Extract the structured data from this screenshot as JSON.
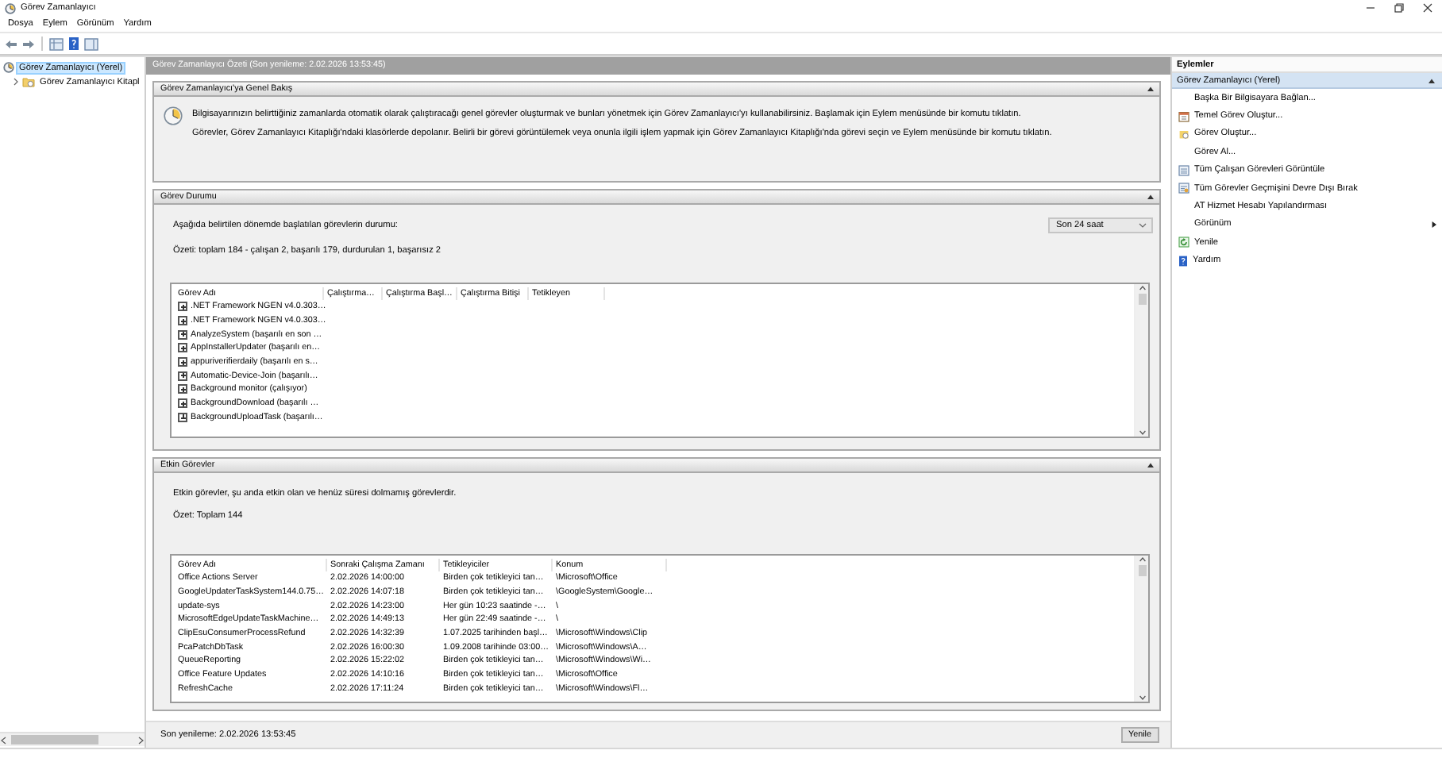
{
  "window": {
    "title": "Görev Zamanlayıcı"
  },
  "menu": [
    {
      "label": "Dosya"
    },
    {
      "label": "Eylem"
    },
    {
      "label": "Görünüm"
    },
    {
      "label": "Yardım"
    }
  ],
  "tree": [
    {
      "label": "Görev Zamanlayıcı (Yerel)",
      "selected": true,
      "children": [
        {
          "label": "Görev Zamanlayıcı Kitapl",
          "selected": false,
          "expanded": false
        }
      ]
    }
  ],
  "summary_header": "Görev Zamanlayıcı Özeti (Son yenileme: 2.02.2026 13:53:45)",
  "overview": {
    "title": "Görev Zamanlayıcı'ya Genel Bakış",
    "expanded": true,
    "paragraphs": [
      "Bilgisayarınızın belirttiğiniz zamanlarda otomatik olarak çalıştıracağı genel görevler oluşturmak ve bunları yönetmek için Görev Zamanlayıcı'yı kullanabilirsiniz. Başlamak için Eylem menüsünde bir komutu tıklatın.",
      "Görevler, Görev Zamanlayıcı Kitaplığı'ndaki klasörlerde depolanır. Belirli bir görevi görüntülemek veya onunla ilgili işlem yapmak için Görev Zamanlayıcı Kitaplığı'nda görevi seçin ve Eylem menüsünde bir komutu tıklatın."
    ]
  },
  "task_status": {
    "title": "Görev Durumu",
    "expanded": true,
    "prompt": "Aşağıda belirtilen dönemde başlatılan görevlerin durumu:",
    "period": "Son 24 saat",
    "summary": "Özeti: toplam 184 - çalışan 2, başarılı 179, durdurulan 1, başarısız 2",
    "columns": [
      "Görev Adı",
      "Çalıştırma…",
      "Çalıştırma Başl…",
      "Çalıştırma Bitişi",
      "Tetikleyen"
    ],
    "rows": [
      {
        "cells": [
          ".NET Framework NGEN v4.0.303…"
        ],
        "expanded": false
      },
      {
        "cells": [
          ".NET Framework NGEN v4.0.303…"
        ],
        "expanded": false
      },
      {
        "cells": [
          "AnalyzeSystem (başarılı en son …"
        ],
        "expanded": false
      },
      {
        "cells": [
          "AppInstallerUpdater (başarılı en…"
        ],
        "expanded": false
      },
      {
        "cells": [
          "appuriverifierdaily (başarılı en s…"
        ],
        "expanded": false
      },
      {
        "cells": [
          "Automatic-Device-Join (başarılı…"
        ],
        "expanded": false
      },
      {
        "cells": [
          "Background monitor (çalışıyor)"
        ],
        "expanded": false
      },
      {
        "cells": [
          "BackgroundDownload (başarılı …"
        ],
        "expanded": false
      },
      {
        "cells": [
          "BackgroundUploadTask (başarılı…"
        ],
        "expanded": false
      }
    ]
  },
  "active_tasks": {
    "title": "Etkin Görevler",
    "expanded": true,
    "description": "Etkin görevler, şu anda etkin olan ve henüz süresi dolmamış görevlerdir.",
    "summary": "Özet: Toplam 144",
    "columns": [
      "Görev Adı",
      "Sonraki Çalışma Zamanı",
      "Tetikleyiciler",
      "Konum"
    ],
    "rows": [
      {
        "cells": [
          "Office Actions Server",
          "2.02.2026 14:00:00",
          "Birden çok tetikleyici tan…",
          "\\Microsoft\\Office"
        ]
      },
      {
        "cells": [
          "GoogleUpdaterTaskSystem144.0.75…",
          "2.02.2026 14:07:18",
          "Birden çok tetikleyici tan…",
          "\\GoogleSystem\\Google…"
        ]
      },
      {
        "cells": [
          "update-sys",
          "2.02.2026 14:23:00",
          "Her gün 10:23 saatinde -…",
          "\\"
        ]
      },
      {
        "cells": [
          "MicrosoftEdgeUpdateTaskMachine…",
          "2.02.2026 14:49:13",
          "Her gün 22:49 saatinde -…",
          "\\"
        ]
      },
      {
        "cells": [
          "ClipEsuConsumerProcessRefund",
          "2.02.2026 14:32:39",
          "1.07.2025 tarihinden başl…",
          "\\Microsoft\\Windows\\Clip"
        ]
      },
      {
        "cells": [
          "PcaPatchDbTask",
          "2.02.2026 16:00:30",
          "1.09.2008 tarihinde 03:00…",
          "\\Microsoft\\Windows\\A…"
        ]
      },
      {
        "cells": [
          "QueueReporting",
          "2.02.2026 15:22:02",
          "Birden çok tetikleyici tan…",
          "\\Microsoft\\Windows\\Wi…"
        ]
      },
      {
        "cells": [
          "Office Feature Updates",
          "2.02.2026 14:10:16",
          "Birden çok tetikleyici tan…",
          "\\Microsoft\\Office"
        ]
      },
      {
        "cells": [
          "RefreshCache",
          "2.02.2026 17:11:24",
          "Birden çok tetikleyici tan…",
          "\\Microsoft\\Windows\\Fl…"
        ]
      }
    ]
  },
  "footer": {
    "last_refresh": "Son yenileme: 2.02.2026 13:53:45",
    "refresh_button": "Yenile"
  },
  "actions": {
    "title": "Eylemler",
    "group": {
      "label": "Görev Zamanlayıcı (Yerel)",
      "expanded": true
    },
    "items": [
      {
        "label": "Başka Bir Bilgisayara Bağlan...",
        "kind": "plain"
      },
      {
        "label": "Temel Görev Oluştur...",
        "kind": "calendar"
      },
      {
        "label": "Görev Oluştur...",
        "kind": "task"
      },
      {
        "label": "Görev Al...",
        "kind": "plain"
      },
      {
        "label": "Tüm Çalışan Görevleri Görüntüle",
        "kind": "list"
      },
      {
        "label": "Tüm Görevler Geçmişini Devre Dışı Bırak",
        "kind": "history"
      },
      {
        "label": "AT Hizmet Hesabı Yapılandırması",
        "kind": "plain"
      },
      {
        "label": "Görünüm",
        "kind": "submenu"
      },
      {
        "label": "Yenile",
        "kind": "refresh"
      },
      {
        "label": "Yardım",
        "kind": "help"
      }
    ]
  }
}
